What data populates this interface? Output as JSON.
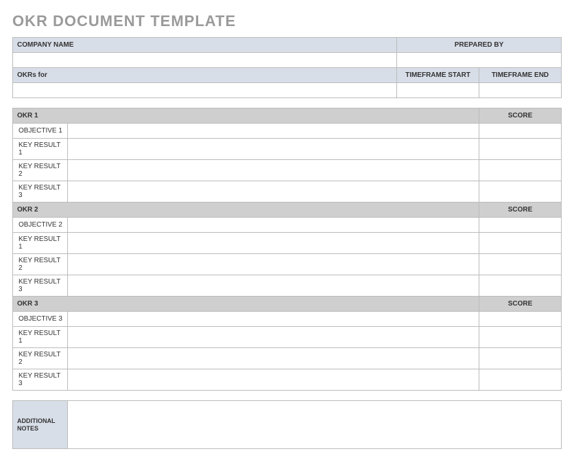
{
  "title": "OKR DOCUMENT TEMPLATE",
  "info": {
    "company_label": "COMPANY NAME",
    "company_value": "",
    "prepared_label": "PREPARED BY",
    "prepared_value": "",
    "okrs_for_label": "OKRs for",
    "okrs_for_value": "",
    "tf_start_label": "TIMEFRAME START",
    "tf_start_value": "",
    "tf_end_label": "TIMEFRAME END",
    "tf_end_value": ""
  },
  "okrs": [
    {
      "header": "OKR 1",
      "score_label": "SCORE",
      "rows": [
        {
          "label": "OBJECTIVE 1",
          "value": "",
          "score": ""
        },
        {
          "label": "KEY RESULT 1",
          "value": "",
          "score": ""
        },
        {
          "label": "KEY RESULT 2",
          "value": "",
          "score": ""
        },
        {
          "label": "KEY RESULT 3",
          "value": "",
          "score": ""
        }
      ]
    },
    {
      "header": "OKR 2",
      "score_label": "SCORE",
      "rows": [
        {
          "label": "OBJECTIVE 2",
          "value": "",
          "score": ""
        },
        {
          "label": "KEY RESULT 1",
          "value": "",
          "score": ""
        },
        {
          "label": "KEY RESULT 2",
          "value": "",
          "score": ""
        },
        {
          "label": "KEY RESULT 3",
          "value": "",
          "score": ""
        }
      ]
    },
    {
      "header": "OKR 3",
      "score_label": "SCORE",
      "rows": [
        {
          "label": "OBJECTIVE 3",
          "value": "",
          "score": ""
        },
        {
          "label": "KEY RESULT 1",
          "value": "",
          "score": ""
        },
        {
          "label": "KEY RESULT 2",
          "value": "",
          "score": ""
        },
        {
          "label": "KEY RESULT 3",
          "value": "",
          "score": ""
        }
      ]
    }
  ],
  "notes": {
    "label": "ADDITIONAL NOTES",
    "value": ""
  }
}
